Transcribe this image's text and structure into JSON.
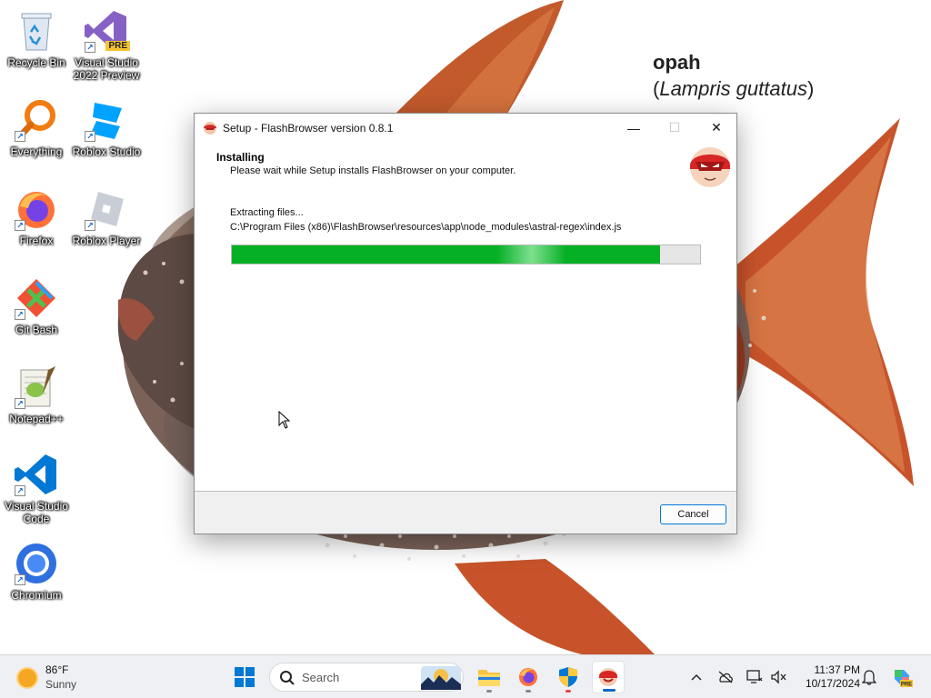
{
  "wallpaper": {
    "common_name": "opah",
    "open_paren": "(",
    "scientific_name": "Lampris guttatus",
    "close_paren": ")"
  },
  "desktop": {
    "icons": [
      {
        "label": "Recycle Bin",
        "icon": "recycle-bin-icon"
      },
      {
        "label": "Visual Studio 2022 Preview",
        "icon": "visual-studio-preview-icon",
        "badge": "PRE"
      },
      {
        "label": "Everything",
        "icon": "everything-search-icon"
      },
      {
        "label": "Roblox Studio",
        "icon": "roblox-studio-icon"
      },
      {
        "label": "Firefox",
        "icon": "firefox-icon"
      },
      {
        "label": "Roblox Player",
        "icon": "roblox-player-icon"
      },
      {
        "label": "Git Bash",
        "icon": "git-bash-icon"
      },
      {
        "label": "Notepad++",
        "icon": "notepad-plus-plus-icon"
      },
      {
        "label": "Visual Studio Code",
        "icon": "vscode-icon"
      },
      {
        "label": "Chromium",
        "icon": "chromium-icon"
      }
    ]
  },
  "setup": {
    "title": "Setup - FlashBrowser version 0.8.1",
    "header_title": "Installing",
    "header_subtitle": "Please wait while Setup installs FlashBrowser on your computer.",
    "status": "Extracting files...",
    "current_file": "C:\\Program Files (x86)\\FlashBrowser\\resources\\app\\node_modules\\astral-regex\\index.js",
    "progress": 0.915,
    "cancel_label": "Cancel",
    "window_buttons": {
      "minimize": "—",
      "maximize": "☐",
      "close": "✕"
    }
  },
  "taskbar": {
    "weather_temp": "86°F",
    "weather_condition": "Sunny",
    "search_placeholder": "Search",
    "apps": [
      "start-icon",
      "file-explorer-icon",
      "firefox-icon",
      "defender-shield-icon",
      "flashbrowser-setup-icon"
    ],
    "time": "11:37 PM",
    "date": "10/17/2024",
    "accent": "#0067c0"
  },
  "colors": {
    "progress_fill": "#06b025",
    "button_border": "#0078d4",
    "fish_body": "#7a6258",
    "fish_fin": "#c8532a"
  }
}
